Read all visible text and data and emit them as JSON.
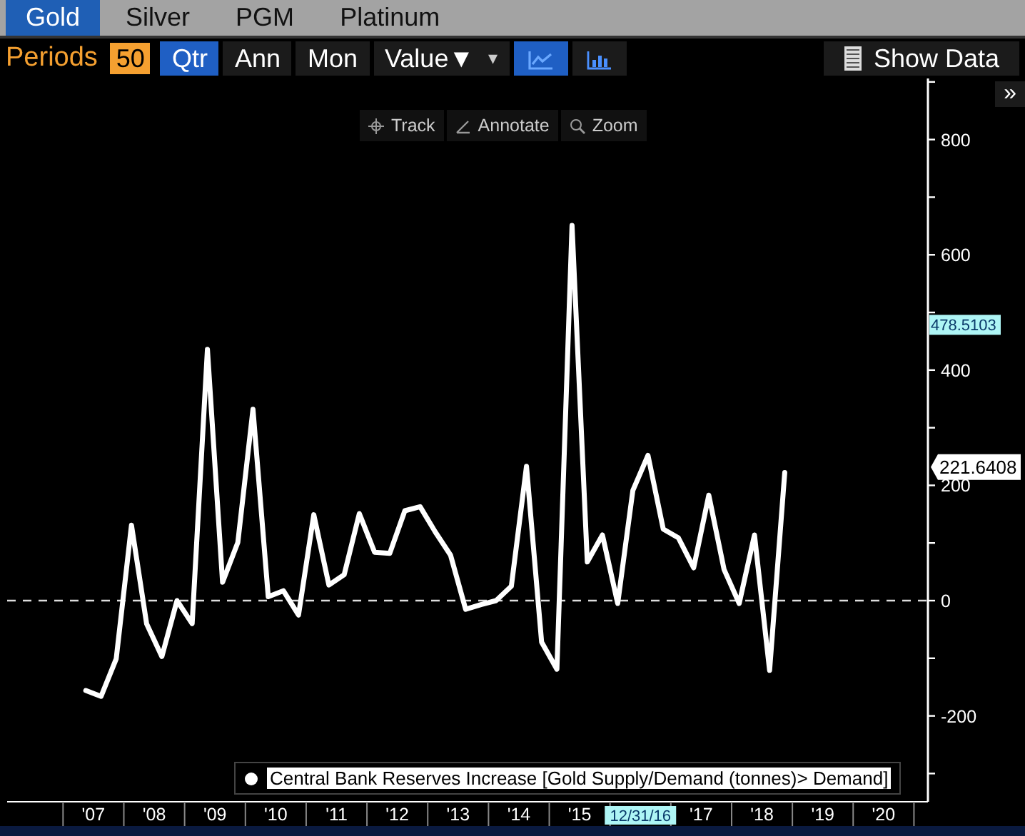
{
  "tabs": [
    {
      "label": "Gold",
      "selected": true
    },
    {
      "label": "Silver",
      "selected": false
    },
    {
      "label": "PGM",
      "selected": false
    },
    {
      "label": "Platinum",
      "selected": false
    }
  ],
  "toolbar": {
    "periods_label": "Periods",
    "periods_value": "50",
    "frequencies": [
      {
        "label": "Qtr",
        "selected": true
      },
      {
        "label": "Ann",
        "selected": false
      },
      {
        "label": "Mon",
        "selected": false
      }
    ],
    "value_dropdown": {
      "label": "Value▼",
      "caret": "▾"
    },
    "chart_styles": [
      {
        "kind": "line",
        "selected": true
      },
      {
        "kind": "bar",
        "selected": false
      }
    ],
    "show_data": "Show Data"
  },
  "chart_tools": [
    {
      "kind": "track",
      "label": "Track"
    },
    {
      "kind": "annotate",
      "label": "Annotate"
    },
    {
      "kind": "zoom",
      "label": "Zoom"
    }
  ],
  "expand_button": "»",
  "chart": {
    "chart_data": {
      "type": "line",
      "xlim": [
        5.58,
        20.73
      ],
      "ylim": [
        -349,
        906
      ],
      "x": [
        6.875,
        7.125,
        7.375,
        7.625,
        7.875,
        8.125,
        8.375,
        8.625,
        8.875,
        9.125,
        9.375,
        9.625,
        9.875,
        10.125,
        10.375,
        10.625,
        10.875,
        11.125,
        11.375,
        11.625,
        11.875,
        12.125,
        12.375,
        12.625,
        12.875,
        13.125,
        13.375,
        13.625,
        13.875,
        14.125,
        14.375,
        14.625,
        14.875,
        15.125,
        15.375,
        15.625,
        15.875,
        16.125,
        16.375,
        16.625,
        16.875,
        17.125,
        17.375,
        17.625,
        17.875,
        18.125,
        18.375
      ],
      "series": [
        {
          "name": "Central Bank Reserves Increase [Gold Supply/Demand (tonnes)> Demand]",
          "color": "#ffffff",
          "values": [
            -156,
            -166,
            -101,
            131,
            -40,
            -97,
            0,
            -40,
            436,
            32,
            101,
            332,
            7,
            17,
            -25,
            149,
            27,
            45,
            151,
            84,
            82,
            156,
            163,
            119,
            79,
            -15,
            -7,
            0,
            25,
            233,
            -72,
            -119,
            651,
            67,
            114,
            -5,
            191,
            252,
            124,
            109,
            57,
            183,
            54,
            -5,
            114,
            -121,
            222
          ]
        }
      ],
      "yticks": [
        -200,
        0,
        200,
        400,
        600,
        800
      ],
      "xticks": [
        {
          "value": 7,
          "label": "'07"
        },
        {
          "value": 8,
          "label": "'08"
        },
        {
          "value": 9,
          "label": "'09"
        },
        {
          "value": 10,
          "label": "'10"
        },
        {
          "value": 11,
          "label": "'11"
        },
        {
          "value": 12,
          "label": "'12"
        },
        {
          "value": 13,
          "label": "'13"
        },
        {
          "value": 14,
          "label": "'14"
        },
        {
          "value": 15,
          "label": "'15"
        },
        {
          "value": 17,
          "label": "'17"
        },
        {
          "value": 18,
          "label": "'18"
        },
        {
          "value": 19,
          "label": "'19"
        },
        {
          "value": 20,
          "label": "'20"
        }
      ]
    },
    "crosshair": {
      "x_label": "12/31/16",
      "y_label": "478.5103"
    },
    "last_value_label": "221.6408"
  }
}
